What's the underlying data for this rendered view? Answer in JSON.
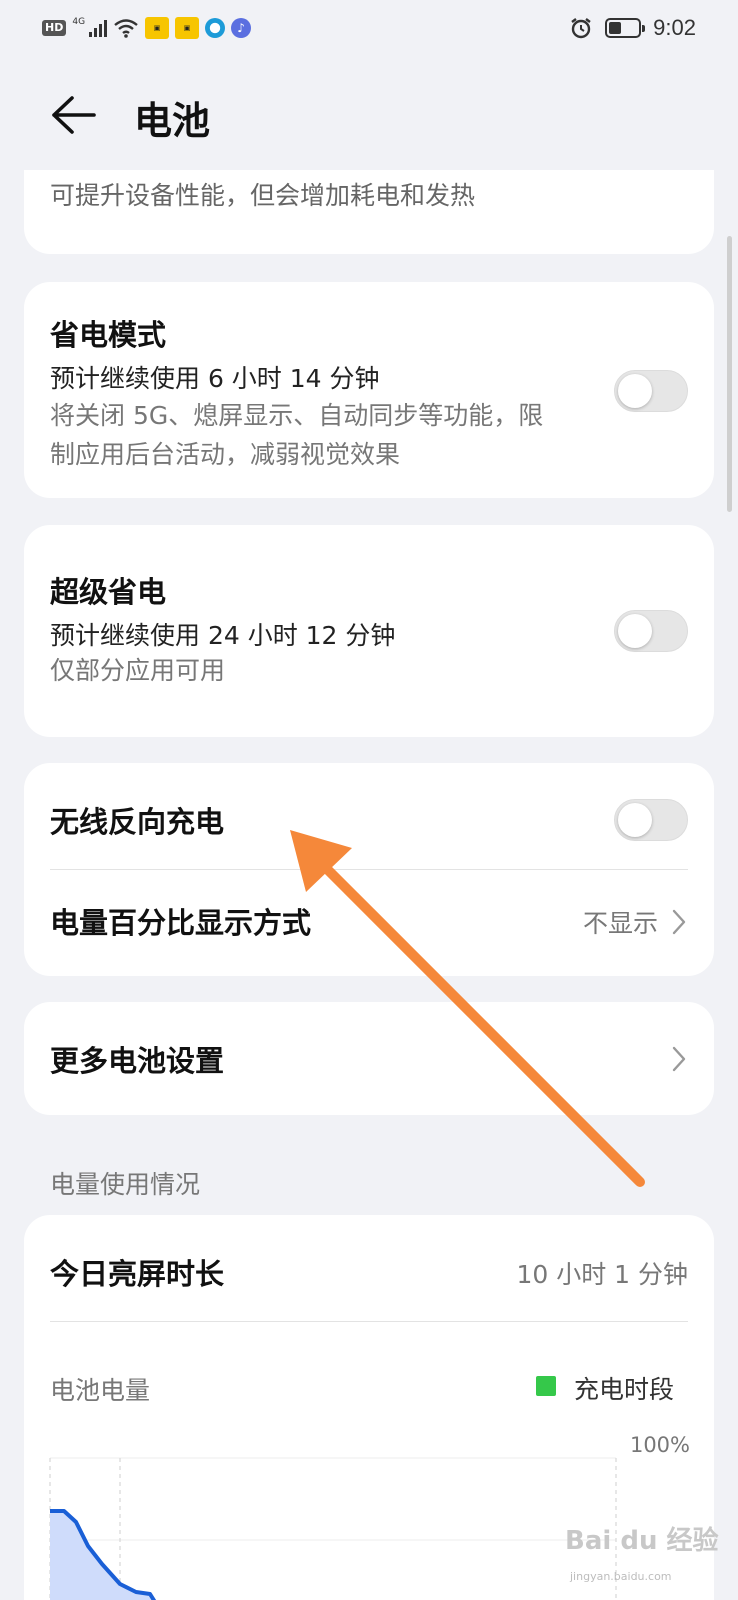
{
  "status_bar": {
    "hd": "HD",
    "network": "4G",
    "time": "9:02",
    "battery_level": 0.4
  },
  "header": {
    "title": "电池"
  },
  "performance_card": {
    "desc": "可提升设备性能，但会增加耗电和发热"
  },
  "power_saving": {
    "title": "省电模式",
    "estimate": "预计继续使用 6 小时 14 分钟",
    "desc": "将关闭 5G、熄屏显示、自动同步等功能，限制应用后台活动，减弱视觉效果",
    "enabled": false
  },
  "super_saving": {
    "title": "超级省电",
    "estimate": "预计继续使用 24 小时 12 分钟",
    "desc": "仅部分应用可用",
    "enabled": false
  },
  "wireless_reverse": {
    "title": "无线反向充电",
    "enabled": false
  },
  "percentage_display": {
    "title": "电量百分比显示方式",
    "value": "不显示"
  },
  "more_settings": {
    "title": "更多电池设置"
  },
  "usage": {
    "section_label": "电量使用情况",
    "screen_time_label": "今日亮屏时长",
    "screen_time_value": "10 小时 1 分钟",
    "battery_label": "电池电量",
    "legend_label": "充电时段",
    "ymax_label": "100%"
  },
  "colors": {
    "accent": "#1a5fd6",
    "charging": "#35c84a",
    "annotation_arrow": "#f5883a"
  },
  "watermark": {
    "brand": "Bai du 经验",
    "url": "jingyan.baidu.com"
  }
}
